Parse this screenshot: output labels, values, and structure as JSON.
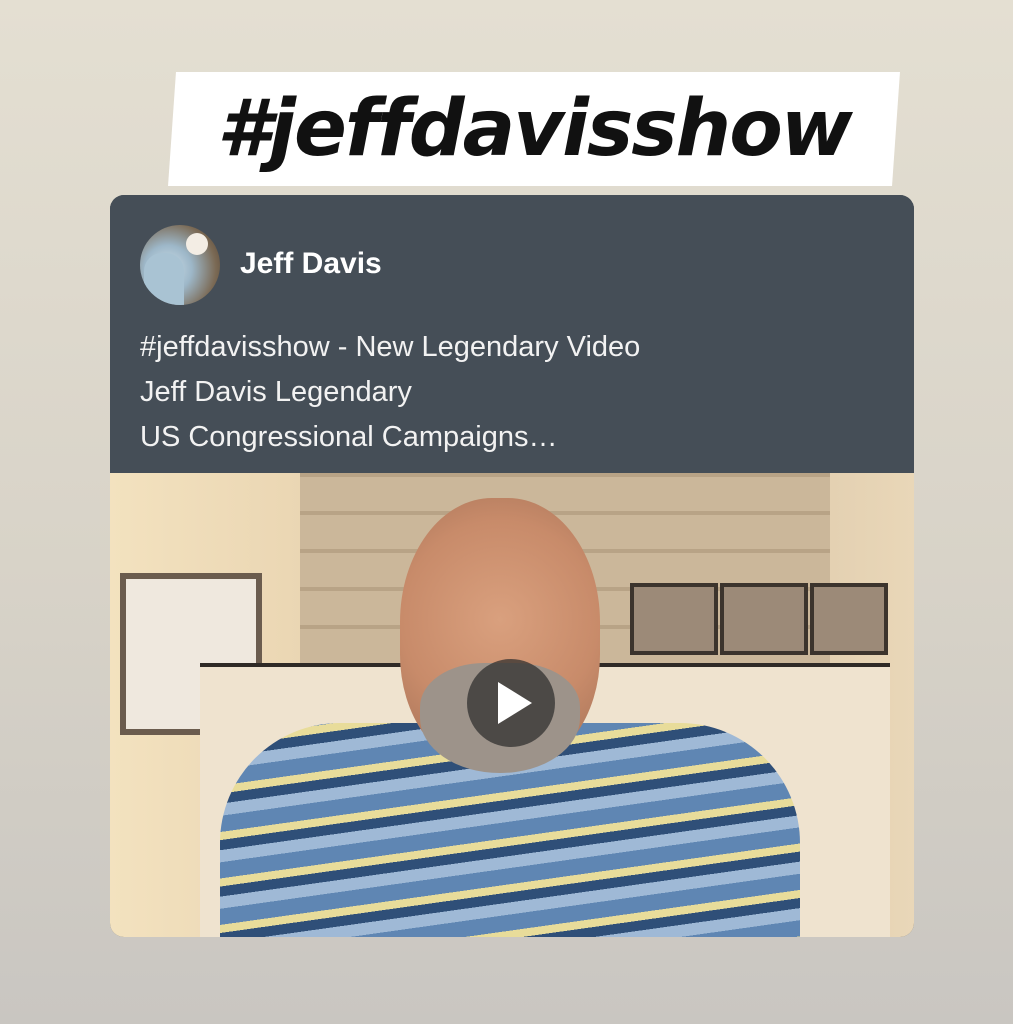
{
  "banner": {
    "hashtag": "#jeffdavisshow"
  },
  "post": {
    "author": {
      "name": "Jeff Davis",
      "avatar_icon": "profile-photo"
    },
    "text_lines": [
      "#jeffdavisshow - New Legendary Video",
      "Jeff Davis Legendary",
      "US Congressional Campaigns…"
    ],
    "video": {
      "play_icon": "play-icon"
    }
  },
  "colors": {
    "card_header": "#454e57",
    "banner_bg": "#ffffff",
    "text_light": "#f2f2f2"
  }
}
